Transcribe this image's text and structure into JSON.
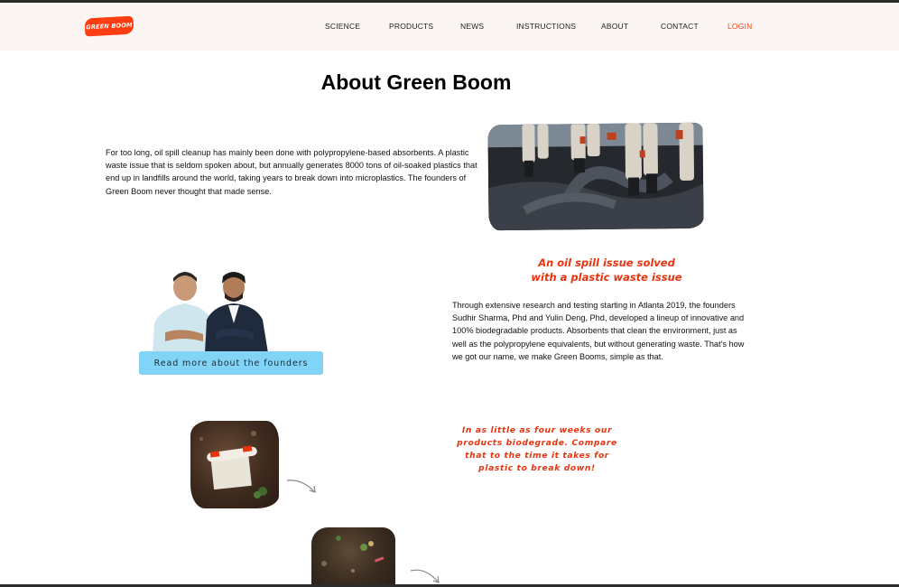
{
  "logo": {
    "text": "GREEN BOOM",
    "color": "#ff3d12"
  },
  "nav": {
    "items": [
      "SCIENCE",
      "PRODUCTS",
      "NEWS",
      "INSTRUCTIONS",
      "ABOUT",
      "CONTACT"
    ],
    "login": "LOGIN"
  },
  "page": {
    "title": "About Green Boom"
  },
  "intro": {
    "text": "For too long, oil spill cleanup has mainly been done with polypropylene-based absorbents. A plastic waste issue that is seldom spoken about, but annually generates 8000 tons of oil-soaked plastics that end up in landfills around the world, taking years to break down into microplastics. The founders of Green Boom never thought that made sense."
  },
  "solution": {
    "heading_line1": "An oil spill issue solved",
    "heading_line2": "with a plastic waste issue",
    "text": "Through extensive research and testing starting in Atlanta 2019, the founders Sudhir Sharma, Phd and Yulin Deng, Phd, developed a lineup of innovative and 100% biodegradable products. Absorbents that clean the environment, just as well as the polypropylene equivalents, but without generating waste. That's how we got our name, we make Green Booms, simple as that."
  },
  "founders": {
    "button_label": "Read more about the founders"
  },
  "biodegrade": {
    "quote": "In as little as four weeks our products biodegrade. Compare that to the time it takes for plastic to break down!"
  },
  "colors": {
    "accent": "#e8340f",
    "button": "#82d4f7",
    "header_bg": "#fbf6f4"
  }
}
